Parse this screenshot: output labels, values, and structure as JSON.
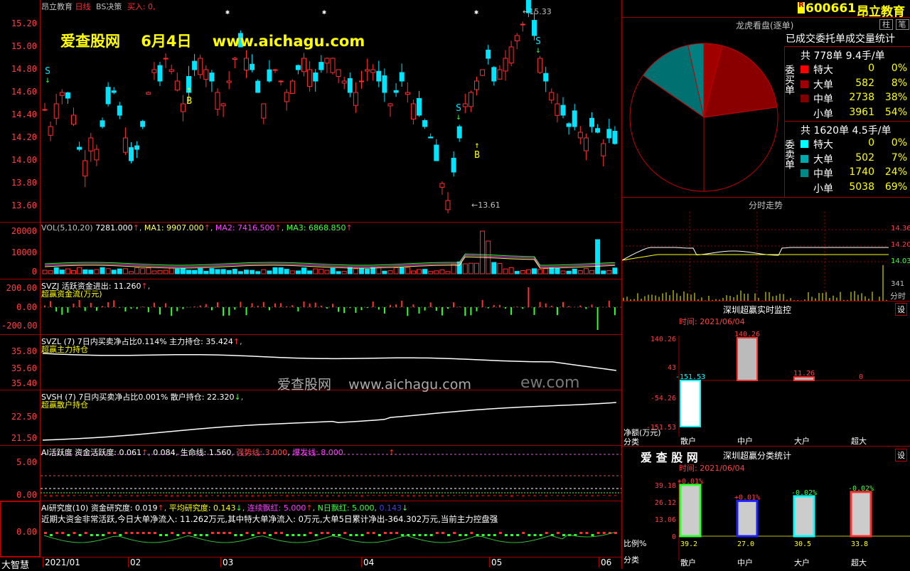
{
  "main": {
    "title": "昂立教育",
    "period": "日线",
    "strategy": "BS决策",
    "signal": "买入: 0,",
    "banner": "爱查股网    6月4日    www.aichagu.com",
    "watermark": "爱查股网    www.aichagu.com",
    "watermark2": "ew.com",
    "high_label": "15.33",
    "low_label": "13.61",
    "yticks": [
      "15.20",
      "15.00",
      "14.80",
      "14.60",
      "14.40",
      "14.20",
      "14.00",
      "13.80",
      "13.60"
    ],
    "marks": [
      "S",
      "B",
      "S",
      "B",
      "S"
    ]
  },
  "vol": {
    "label": "VOL(5,10,20)",
    "v": "7281.000",
    "ma1": "MA1: 9907.000",
    "ma2": "MA2: 7416.500",
    "ma3": "MA3: 6868.850",
    "yticks": [
      "20000",
      "10000",
      "0"
    ]
  },
  "svzj": {
    "line1": "SVZJ  活跃资金进出: 11.260",
    "line2": "超赢资金流(万元)",
    "yticks": [
      "200.00",
      "0.00",
      "-200.00"
    ]
  },
  "svzl": {
    "line1": "SVZL (7) 7日内买卖净占比0.114% 主力持仓: 35.424",
    "line2": "超赢主力持仓",
    "yticks": [
      "35.80",
      "35.60",
      "35.40"
    ]
  },
  "svsh": {
    "line1": "SVSH (7) 7日内买卖净占比0.001% 散户持仓: 22.320",
    "line2": "超赢散户持仓",
    "yticks": [
      "22.50",
      "21.50"
    ]
  },
  "ai": {
    "line1": "AI活跃度 资金活跃度: 0.061",
    "v2": "0.084",
    "sm": "生命线: 1.560",
    "qs": "强势线: 3.000",
    "bf": "爆发线: 8.000",
    "yticks": [
      "5.00",
      "0.00"
    ]
  },
  "air": {
    "line1": "AI研究度(10) 资金研究度: 0.019",
    "pj": "平均研究度: 0.143",
    "lx": "连续飘红: 5.000",
    "nr": "N日飘红: 5.000",
    "v": "0.143",
    "line2": "近期大资金非常活跃,今日大单净流入: 11.262万元,其中特大单净流入: 0万元,大单5日累计净出-364.302万元,当前主力控盘强",
    "ytick": "0.00",
    "corner": "大智慧"
  },
  "dates": [
    "2021/01",
    "02",
    "03",
    "04",
    "05",
    "06"
  ],
  "header": {
    "code": "600661",
    "name": "昂立教育",
    "badge": "R"
  },
  "lhkp": {
    "title": "龙虎看盘(逐单)",
    "tabs": [
      "柱",
      "笔"
    ],
    "sub": "已成交委托单成交量统计",
    "buy": {
      "side": "委买单",
      "total": "共 778单 9.4手/单",
      "rows": [
        {
          "k": "特大",
          "n": "0",
          "p": "0%"
        },
        {
          "k": "大单",
          "n": "582",
          "p": "8%"
        },
        {
          "k": "中单",
          "n": "2738",
          "p": "38%"
        },
        {
          "k": "小单",
          "n": "3961",
          "p": "54%"
        }
      ]
    },
    "sell": {
      "side": "委卖单",
      "total": "共 1620单 4.5手/单",
      "rows": [
        {
          "k": "特大",
          "n": "0",
          "p": "0%"
        },
        {
          "k": "大单",
          "n": "502",
          "p": "7%"
        },
        {
          "k": "中单",
          "n": "1740",
          "p": "24%"
        },
        {
          "k": "小单",
          "n": "5038",
          "p": "69%"
        }
      ]
    }
  },
  "fenshi": {
    "title": "分时走势",
    "p1": "14.36",
    "p2": "14.20",
    "p3": "14.03",
    "vol": "341",
    "lbl": "分时"
  },
  "monitor": {
    "title": "深圳超赢实时监控",
    "set": "设",
    "time": "时间: 2021/06/04",
    "yticks": [
      "140.26",
      "43",
      "-54.26",
      "-151.53"
    ],
    "vals": [
      "-151.53",
      "140.26",
      "11.26",
      "0"
    ],
    "ylabel": "净额(万元)",
    "xlabel": "分类",
    "cats": [
      "散户",
      "中户",
      "大户",
      "超大"
    ]
  },
  "stats": {
    "brand": "爱 查 股 网",
    "title": "深圳超赢分类统计",
    "set": "设",
    "time": "时间: 2021/06/04",
    "yticks": [
      "39.18",
      "26.12",
      "13.06",
      "0"
    ],
    "pct": [
      "+0.01%",
      "+0.01%",
      "-0.02%",
      "-0.02%"
    ],
    "vals": [
      "39.2",
      "27.0",
      "30.5",
      "33.8"
    ],
    "ylabel": "比例%",
    "xlabel": "分类",
    "cats": [
      "散户",
      "中户",
      "大户",
      "超大"
    ]
  },
  "chart_data": {
    "type": "pie",
    "title": "龙虎看盘(逐单)",
    "slices": [
      {
        "name": "特大",
        "value": 0
      },
      {
        "name": "大单",
        "value": 582
      },
      {
        "name": "中单",
        "value": 2738
      },
      {
        "name": "小单",
        "value": 3961
      },
      {
        "name": "特大",
        "value": 0
      },
      {
        "name": "大单",
        "value": 502
      },
      {
        "name": "中单",
        "value": 1740
      },
      {
        "name": "小单",
        "value": 5038
      }
    ]
  }
}
